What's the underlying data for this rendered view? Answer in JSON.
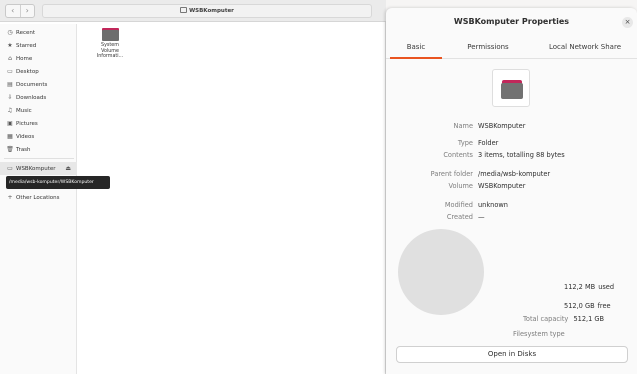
{
  "file_manager": {
    "nav": {
      "back": "‹",
      "forward": "›"
    },
    "path_title": "WSBKomputer",
    "sidebar": [
      {
        "icon": "◷",
        "label": "Recent"
      },
      {
        "icon": "★",
        "label": "Starred"
      },
      {
        "icon": "⌂",
        "label": "Home"
      },
      {
        "icon": "▭",
        "label": "Desktop"
      },
      {
        "icon": "▤",
        "label": "Documents"
      },
      {
        "icon": "⇩",
        "label": "Downloads"
      },
      {
        "icon": "♫",
        "label": "Music"
      },
      {
        "icon": "▣",
        "label": "Pictures"
      },
      {
        "icon": "▦",
        "label": "Videos"
      },
      {
        "icon": "🗑",
        "label": "Trash"
      },
      {
        "icon": "▭",
        "label": "WSBKomputer",
        "eject": "⏏"
      },
      {
        "icon": "+",
        "label": "Other Locations"
      }
    ],
    "tooltip": "/media/wsb-komputer/WSBKomputer",
    "files": [
      {
        "name_lines": [
          "System",
          "Volume",
          "Informati..."
        ]
      }
    ]
  },
  "dialog": {
    "title": "WSBKomputer Properties",
    "close": "×",
    "tabs": [
      "Basic",
      "Permissions",
      "Local Network Share"
    ],
    "active_tab": "Basic",
    "props": {
      "name": {
        "key": "Name",
        "value": "WSBKomputer"
      },
      "type": {
        "key": "Type",
        "value": "Folder"
      },
      "contents": {
        "key": "Contents",
        "value": "3 items, totalling 88 bytes"
      },
      "parent": {
        "key": "Parent folder",
        "value": "/media/wsb-komputer"
      },
      "volume": {
        "key": "Volume",
        "value": "WSBKomputer"
      },
      "modified": {
        "key": "Modified",
        "value": "unknown"
      },
      "created": {
        "key": "Created",
        "value": "—"
      }
    },
    "usage": {
      "used_value": "112,2 MB",
      "used_label": "used",
      "free_value": "512,0 GB",
      "free_label": "free",
      "total_label": "Total capacity",
      "total_value": "512,1 GB",
      "fs_label": "Filesystem type"
    },
    "open_button": "Open in Disks"
  }
}
